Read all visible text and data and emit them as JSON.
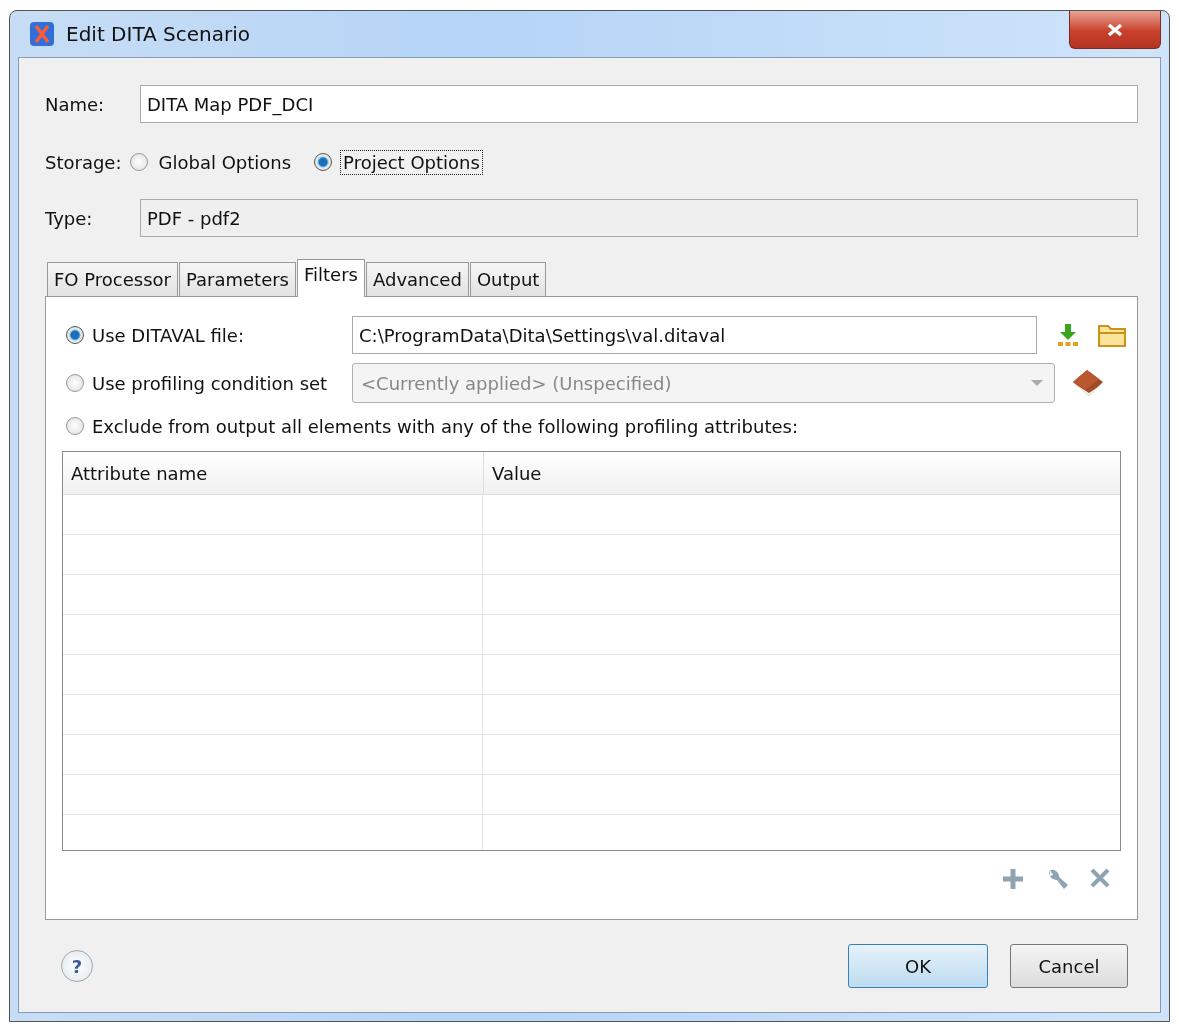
{
  "window": {
    "title": "Edit DITA Scenario"
  },
  "name": {
    "label": "Name:",
    "value": "DITA Map PDF_DCI"
  },
  "storage": {
    "label": "Storage:",
    "options": [
      {
        "label": "Global Options",
        "selected": false,
        "focused": false
      },
      {
        "label": "Project Options",
        "selected": true,
        "focused": true
      }
    ]
  },
  "type": {
    "label": "Type:",
    "value": "PDF - pdf2"
  },
  "tabs": [
    {
      "label": "FO Processor",
      "selected": false
    },
    {
      "label": "Parameters",
      "selected": false
    },
    {
      "label": "Filters",
      "selected": true
    },
    {
      "label": "Advanced",
      "selected": false
    },
    {
      "label": "Output",
      "selected": false
    }
  ],
  "filters": {
    "options": [
      {
        "kind": "file",
        "label": "Use DITAVAL file:",
        "selected": true,
        "value": "C:\\ProgramData\\Dita\\Settings\\val.ditaval"
      },
      {
        "kind": "combo",
        "label": "Use profiling condition set",
        "selected": false,
        "value": "<Currently applied> (Unspecified)",
        "disabled": true
      },
      {
        "kind": "table",
        "label": "Exclude from output all elements with any of the following profiling attributes:",
        "selected": false
      }
    ],
    "table": {
      "columns": [
        "Attribute name",
        "Value"
      ]
    }
  },
  "help": "?",
  "buttons": [
    {
      "label": "OK",
      "default": true
    },
    {
      "label": "Cancel",
      "default": false
    }
  ]
}
